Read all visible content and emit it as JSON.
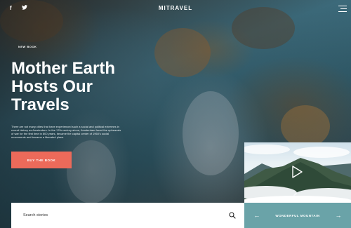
{
  "header": {
    "brand": "MITRAVEL",
    "social": [
      "facebook-icon",
      "twitter-icon"
    ],
    "menu_icon": "hamburger-icon"
  },
  "hero": {
    "badge": "NEW BOOK",
    "title": "Mother Earth Hosts Our Travels",
    "description": "There are not many cities that have experienced such a social and political extremes in recent history as Amsterdam. In the 17th century alone, Amsterdam faced the upheavals of war for the first time in 800 years, became the capital center of 1960's social movements and became a liberated place.",
    "cta_label": "BUY THE BOOK",
    "cta_color": "#ec6a5a"
  },
  "search": {
    "placeholder": "Search stories",
    "icon": "search-icon"
  },
  "video_card": {
    "play_icon": "play-icon",
    "title": "WONDERFUL MOUNTAIN",
    "prev_icon": "arrow-left-icon",
    "next_icon": "arrow-right-icon",
    "nav_color": "#6aa3a8"
  }
}
